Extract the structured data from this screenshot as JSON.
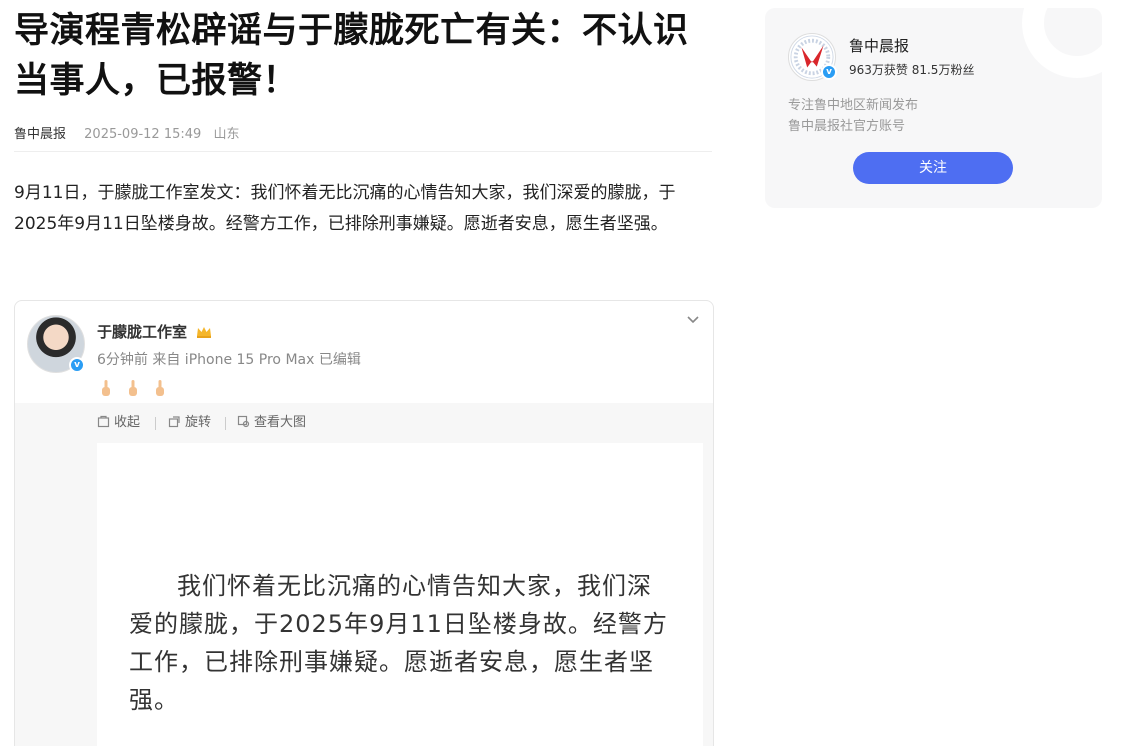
{
  "article": {
    "title_line1": "导演程青松辟谣与于朦胧死亡有关：不认识",
    "title_line2": "当事人，已报警！",
    "source": "鲁中晨报",
    "date": "2025-09-12 15:49",
    "location": "山东",
    "body": "9月11日，于朦胧工作室发文：我们怀着无比沉痛的心情告知大家，我们深爱的朦胧，于2025年9月11日坠楼身故。经警方工作，已排除刑事嫌疑。愿逝者安息，愿生者坚强。"
  },
  "weibo_card": {
    "poster_name": "于朦胧工作室",
    "post_meta": "6分钟前 来自 iPhone 15 Pro Max 已编辑",
    "emojis": [
      "hand-icon",
      "hand-icon",
      "hand-icon"
    ],
    "toolbar": {
      "collapse": "收起",
      "rotate": "旋转",
      "view_large": "查看大图"
    },
    "image_text": "我们怀着无比沉痛的心情告知大家，我们深爱的朦胧，于2025年9月11日坠楼身故。经警方工作，已排除刑事嫌疑。愿逝者安息，愿生者坚强。"
  },
  "sidebar": {
    "account_name": "鲁中晨报",
    "stats": "963万获赞 81.5万粉丝",
    "desc_line1": "专注鲁中地区新闻发布",
    "desc_line2": "鲁中晨报社官方账号",
    "follow_label": "关注",
    "accent_color": "#4e6ef2"
  }
}
